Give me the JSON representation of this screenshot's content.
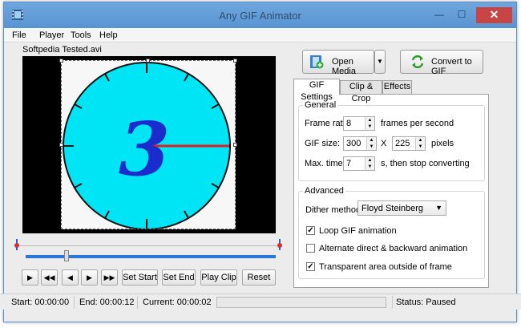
{
  "window": {
    "title": "Any GIF Animator"
  },
  "menu": [
    "File",
    "Player",
    "Tools",
    "Help"
  ],
  "file_name": "Softpedia Tested.avi",
  "clock_digit": "3",
  "transport": {
    "play": "▶",
    "rewind": "◀◀",
    "step_back": "◀",
    "step_fwd": "▶",
    "fast_fwd": "▶▶",
    "set_start": "Set Start",
    "set_end": "Set End",
    "play_clip": "Play Clip",
    "reset": "Reset"
  },
  "actions": {
    "open_media": "Open Media",
    "convert": "Convert to GIF"
  },
  "tabs": [
    "GIF Settings",
    "Clip & Crop",
    "Effects"
  ],
  "general": {
    "legend": "General",
    "frame_rate_label": "Frame rate:",
    "frame_rate_value": "8",
    "frame_rate_unit": "frames per second",
    "gif_size_label": "GIF size:",
    "width_value": "300",
    "times": "X",
    "height_value": "225",
    "size_unit": "pixels",
    "max_time_label": "Max. time:",
    "max_time_value": "7",
    "max_time_unit": "s, then stop converting"
  },
  "advanced": {
    "legend": "Advanced",
    "dither_label": "Dither method:",
    "dither_value": "Floyd Steinberg",
    "loop_label": "Loop GIF animation",
    "loop_checked": true,
    "alternate_label": "Alternate direct & backward animation",
    "alternate_checked": false,
    "transparent_label": "Transparent area outside of frame",
    "transparent_checked": true
  },
  "status": {
    "start": "Start: 00:00:00",
    "end": "End: 00:00:12",
    "current": "Current: 00:00:02",
    "state": "Status: Paused"
  },
  "progress": 0,
  "colors": {
    "clock_face": "#00e5f5",
    "digit": "#1c2ccc",
    "hand": "#e02020",
    "seek": "#2b78d8"
  }
}
